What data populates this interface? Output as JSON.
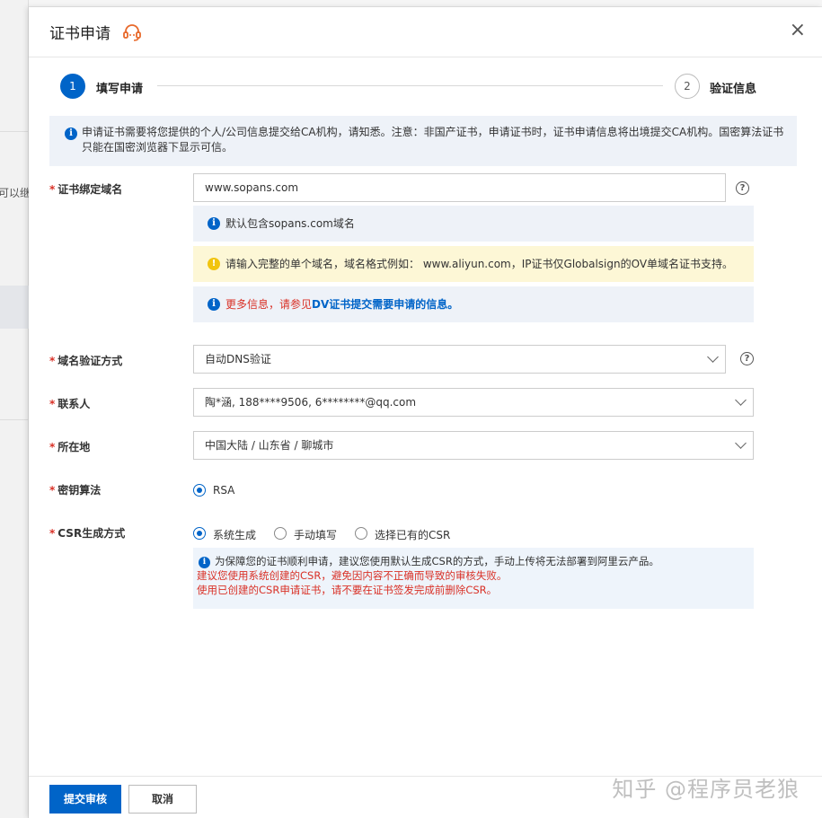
{
  "background": {
    "side_text": "可以继"
  },
  "drawer": {
    "title": "证书申请",
    "close_symbol": "×"
  },
  "steps": [
    {
      "number": "1",
      "label": "填写申请",
      "active": true
    },
    {
      "number": "2",
      "label": "验证信息",
      "active": false
    }
  ],
  "notice": "申请证书需要将您提供的个人/公司信息提交给CA机构，请知悉。注意：非国产证书，申请证书时，证书申请信息将出境提交CA机构。国密算法证书只能在国密浏览器下显示可信。",
  "form": {
    "domain": {
      "label": "证书绑定域名",
      "value": "www.sopans.com",
      "tip_default": "默认包含sopans.com域名",
      "tip_warning": "请输入完整的单个域名，域名格式例如： www.aliyun.com，IP证书仅Globalsign的OV单域名证书支持。",
      "tip_more_red": "更多信息，请参见",
      "tip_more_link": "DV证书提交需要申请的信息。"
    },
    "verify_method": {
      "label": "域名验证方式",
      "value": "自动DNS验证"
    },
    "contact": {
      "label": "联系人",
      "value": "陶*涵, 188****9506, 6********@qq.com"
    },
    "location": {
      "label": "所在地",
      "value": "中国大陆 / 山东省 / 聊城市"
    },
    "key_algorithm": {
      "label": "密钥算法",
      "options": [
        "RSA"
      ],
      "selected": "RSA"
    },
    "csr_method": {
      "label": "CSR生成方式",
      "options": [
        "系统生成",
        "手动填写",
        "选择已有的CSR"
      ],
      "selected": "系统生成",
      "note_line1": "为保障您的证书顺利申请，建议您使用默认生成CSR的方式，手动上传将无法部署到阿里云产品。",
      "note_line2": "建议您使用系统创建的CSR，避免因内容不正确而导致的审核失败。",
      "note_line3": "使用已创建的CSR申请证书，请不要在证书签发完成前删除CSR。"
    }
  },
  "footer": {
    "submit_label": "提交审核",
    "cancel_label": "取消"
  },
  "watermark": "知乎 @程序员老狼",
  "colors": {
    "primary": "#0064c8",
    "required": "#d93026",
    "warning_bg": "#fdf7d6",
    "info_bg": "#eef2f8",
    "service_icon": "#e8692b"
  }
}
